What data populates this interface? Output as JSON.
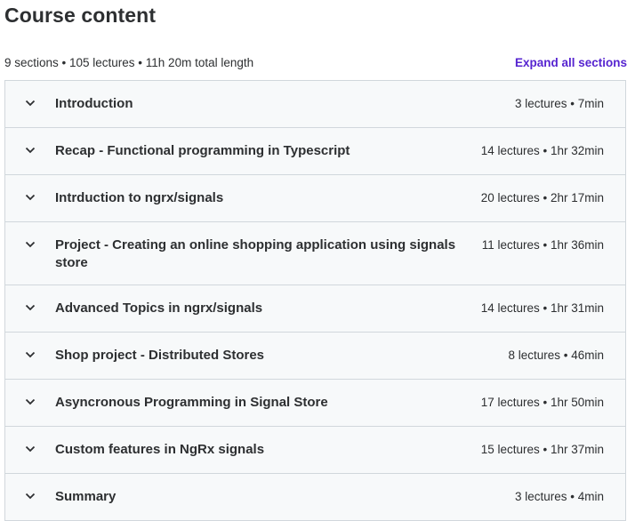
{
  "header": {
    "title": "Course content",
    "meta": "9 sections • 105 lectures • 11h 20m total length",
    "expand_label": "Expand all sections"
  },
  "sections": [
    {
      "title": "Introduction",
      "meta": "3 lectures • 7min"
    },
    {
      "title": "Recap - Functional programming in Typescript",
      "meta": "14 lectures • 1hr 32min"
    },
    {
      "title": "Intrduction to ngrx/signals",
      "meta": "20 lectures • 2hr 17min"
    },
    {
      "title": "Project - Creating an online shopping application using signals store",
      "meta": "11 lectures • 1hr 36min"
    },
    {
      "title": "Advanced Topics in ngrx/signals",
      "meta": "14 lectures • 1hr 31min"
    },
    {
      "title": "Shop project - Distributed Stores",
      "meta": "8 lectures • 46min"
    },
    {
      "title": "Asyncronous Programming in Signal Store",
      "meta": "17 lectures • 1hr 50min"
    },
    {
      "title": "Custom features in NgRx signals",
      "meta": "15 lectures • 1hr 37min"
    },
    {
      "title": "Summary",
      "meta": "3 lectures • 4min"
    }
  ],
  "icons": {
    "section_toggle": "chevron-down-icon"
  },
  "colors": {
    "accent": "#5624d0",
    "section_bg": "#f7f9fa",
    "border": "#d1d7dc",
    "text": "#2d2f31"
  }
}
